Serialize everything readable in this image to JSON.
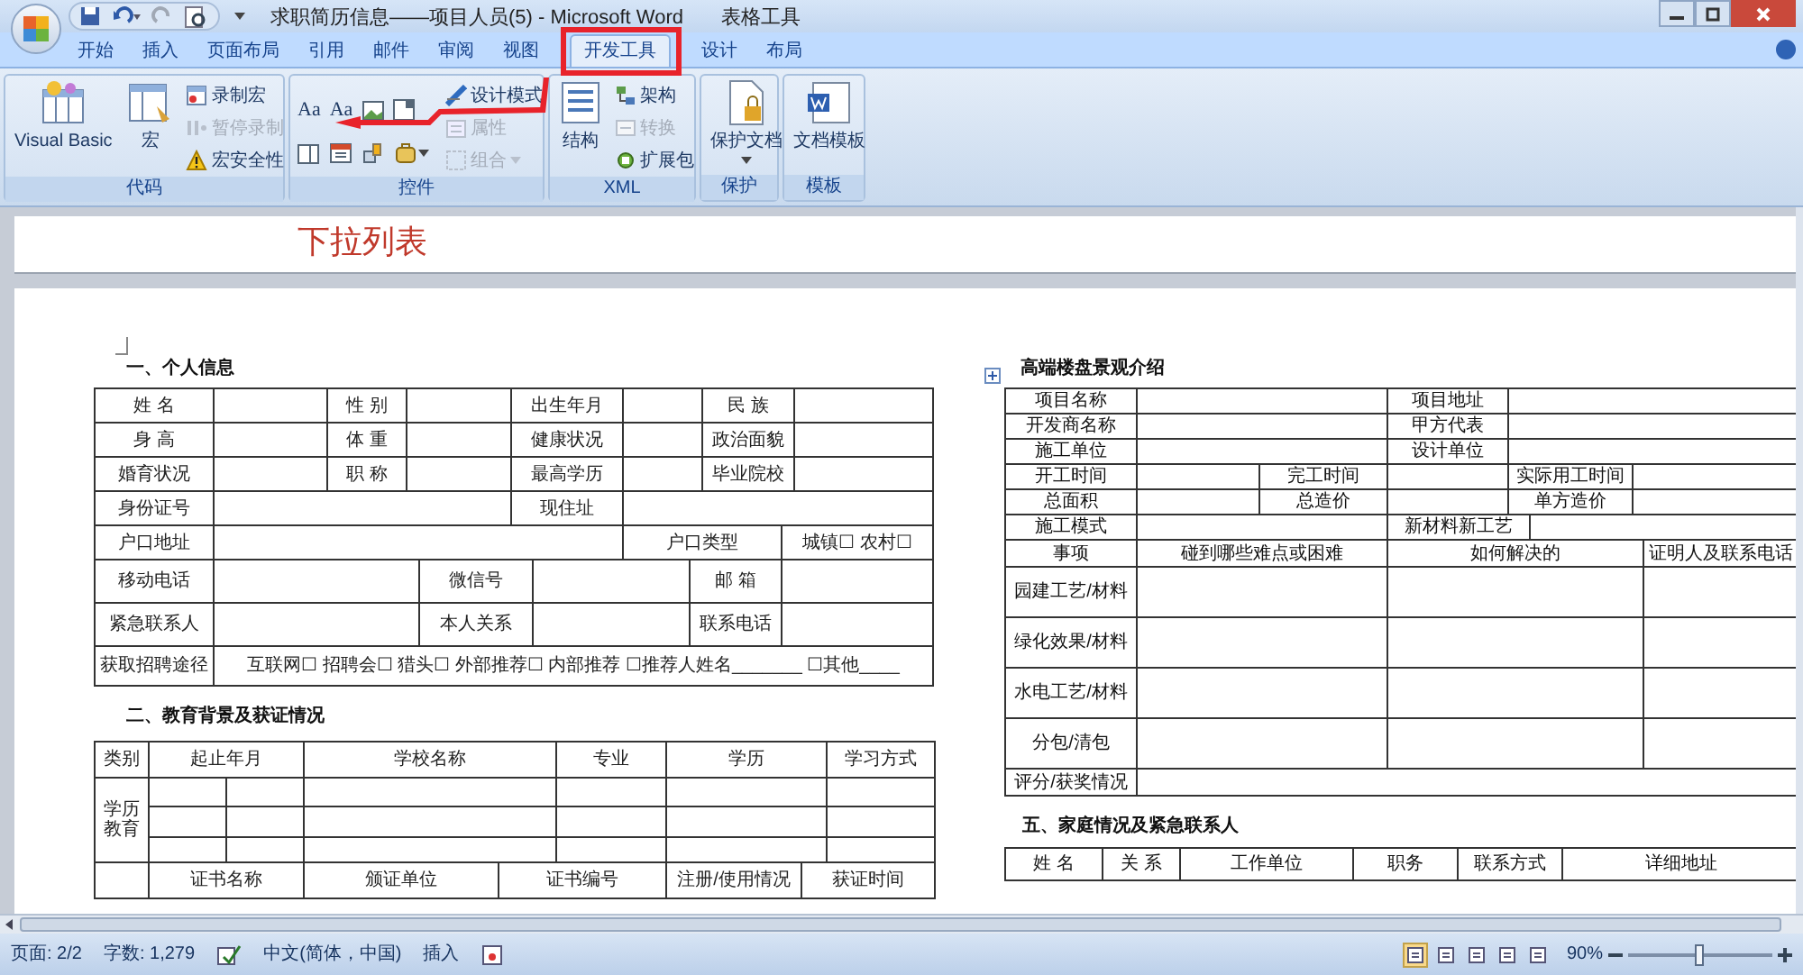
{
  "window": {
    "title": "求职简历信息——项目人员(5) - Microsoft Word",
    "context_label": "表格工具"
  },
  "tabs": [
    {
      "label": "开始",
      "selected": false
    },
    {
      "label": "插入",
      "selected": false
    },
    {
      "label": "页面布局",
      "selected": false
    },
    {
      "label": "引用",
      "selected": false
    },
    {
      "label": "邮件",
      "selected": false
    },
    {
      "label": "审阅",
      "selected": false
    },
    {
      "label": "视图",
      "selected": false
    },
    {
      "label": "开发工具",
      "selected": true
    },
    {
      "label": "设计",
      "selected": false
    },
    {
      "label": "布局",
      "selected": false
    }
  ],
  "ribbon": {
    "groups": [
      {
        "label": "代码",
        "items": [
          {
            "label": "Visual Basic",
            "disabled": false
          },
          {
            "label": "宏",
            "disabled": false
          },
          {
            "label": "录制宏",
            "disabled": false
          },
          {
            "label": "暂停录制",
            "disabled": true
          },
          {
            "label": "宏安全性",
            "disabled": false
          }
        ]
      },
      {
        "label": "控件",
        "items": [
          {
            "label": "Aa",
            "disabled": false
          },
          {
            "label": "Aa",
            "disabled": false
          },
          {
            "label": "设计模式",
            "disabled": false
          },
          {
            "label": "属性",
            "disabled": true
          },
          {
            "label": "组合",
            "disabled": true
          }
        ]
      },
      {
        "label": "XML",
        "items": [
          {
            "label": "结构",
            "disabled": false
          },
          {
            "label": "架构",
            "disabled": false
          },
          {
            "label": "转换",
            "disabled": true
          },
          {
            "label": "扩展包",
            "disabled": false
          }
        ]
      },
      {
        "label": "保护",
        "items": [
          {
            "label": "保护文档",
            "disabled": false
          }
        ]
      },
      {
        "label": "模板",
        "items": [
          {
            "label": "文档模板",
            "disabled": false
          }
        ]
      }
    ]
  },
  "document": {
    "previous_page": {
      "text": "下拉列表"
    },
    "left_column": [
      {
        "title": "一、个人信息",
        "table": {
          "rows": [
            [
              {
                "text": "姓 名"
              },
              {
                "text": ""
              },
              {
                "text": "性 别"
              },
              {
                "text": "",
                "colspan": 2
              },
              {
                "text": "出生年月",
                "colspan": 2
              },
              {
                "text": "",
                "colspan": 2
              },
              {
                "text": "民 族",
                "colspan": 2
              },
              {
                "text": ""
              }
            ],
            [
              {
                "text": "身 高"
              },
              {
                "text": ""
              },
              {
                "text": "体 重"
              },
              {
                "text": "",
                "colspan": 2
              },
              {
                "text": "健康状况",
                "colspan": 2
              },
              {
                "text": "",
                "colspan": 2
              },
              {
                "text": "政治面貌",
                "colspan": 2
              },
              {
                "text": ""
              }
            ],
            [
              {
                "text": "婚育状况"
              },
              {
                "text": ""
              },
              {
                "text": "职 称"
              },
              {
                "text": "",
                "colspan": 2
              },
              {
                "text": "最高学历",
                "colspan": 2
              },
              {
                "text": "",
                "colspan": 2
              },
              {
                "text": "毕业院校",
                "colspan": 2
              },
              {
                "text": ""
              }
            ],
            [
              {
                "text": "身份证号"
              },
              {
                "text": "",
                "colspan": 4
              },
              {
                "text": "现住址",
                "colspan": 2
              },
              {
                "text": "",
                "colspan": 5
              }
            ],
            [
              {
                "text": "户口地址"
              },
              {
                "text": "",
                "colspan": 6
              },
              {
                "text": "户口类型",
                "colspan": 3
              },
              {
                "text": "城镇☐ 农村☐",
                "colspan": 2
              }
            ],
            [
              {
                "text": "移动电话"
              },
              {
                "text": "",
                "colspan": 3
              },
              {
                "text": "微信号",
                "colspan": 2
              },
              {
                "text": "",
                "colspan": 2
              },
              {
                "text": "邮 箱",
                "colspan": 2
              },
              {
                "text": "",
                "colspan": 2
              }
            ],
            [
              {
                "text": "紧急联系人"
              },
              {
                "text": "",
                "colspan": 3
              },
              {
                "text": "本人关系",
                "colspan": 2
              },
              {
                "text": "",
                "colspan": 2
              },
              {
                "text": "联系电话",
                "colspan": 2
              },
              {
                "text": "",
                "colspan": 2
              }
            ],
            [
              {
                "text": "获取招聘途径"
              },
              {
                "text": "互联网☐ 招聘会☐ 猎头☐ 外部推荐☐ 内部推荐 ☐推荐人姓名_______ ☐其他____",
                "colspan": 11
              }
            ]
          ]
        }
      },
      {
        "title": "二、教育背景及获证情况",
        "table": {
          "rows": [
            [
              {
                "text": "类别"
              },
              {
                "text": "起止年月",
                "colspan": 2
              },
              {
                "text": "学校名称",
                "colspan": 2
              },
              {
                "text": "专业"
              },
              {
                "text": "学历",
                "colspan": 2
              },
              {
                "text": "学习方式"
              }
            ],
            [
              {
                "text": "学历教育",
                "rowspan": 3
              },
              {
                "text": ""
              },
              {
                "text": ""
              },
              {
                "text": "",
                "colspan": 2
              },
              {
                "text": ""
              },
              {
                "text": "",
                "colspan": 2
              },
              {
                "text": ""
              }
            ],
            [
              {
                "text": ""
              },
              {
                "text": ""
              },
              {
                "text": "",
                "colspan": 2
              },
              {
                "text": ""
              },
              {
                "text": "",
                "colspan": 2
              },
              {
                "text": ""
              }
            ],
            [
              {
                "text": ""
              },
              {
                "text": ""
              },
              {
                "text": "",
                "colspan": 2
              },
              {
                "text": ""
              },
              {
                "text": "",
                "colspan": 2
              },
              {
                "text": ""
              }
            ],
            [
              {
                "text": ""
              },
              {
                "text": "证书名称",
                "colspan": 2
              },
              {
                "text": "颁证单位"
              },
              {
                "text": "证书编号",
                "colspan": 2
              },
              {
                "text": "注册/使用情况"
              },
              {
                "text": "获证时间",
                "colspan": 2
              }
            ]
          ]
        }
      }
    ],
    "right_column": [
      {
        "title": "高端楼盘景观介绍",
        "table": {
          "rows": [
            [
              {
                "text": "项目名称"
              },
              {
                "text": "",
                "colspan": 2
              },
              {
                "text": "项目地址"
              },
              {
                "text": "",
                "colspan": 4
              }
            ],
            [
              {
                "text": "开发商名称"
              },
              {
                "text": "",
                "colspan": 2
              },
              {
                "text": "甲方代表"
              },
              {
                "text": "",
                "colspan": 4
              }
            ],
            [
              {
                "text": "施工单位"
              },
              {
                "text": "",
                "colspan": 2
              },
              {
                "text": "设计单位"
              },
              {
                "text": "",
                "colspan": 4
              }
            ],
            [
              {
                "text": "开工时间"
              },
              {
                "text": ""
              },
              {
                "text": "完工时间"
              },
              {
                "text": ""
              },
              {
                "text": "实际用工时间",
                "colspan": 2
              },
              {
                "text": "",
                "colspan": 2
              }
            ],
            [
              {
                "text": "总面积"
              },
              {
                "text": ""
              },
              {
                "text": "总造价"
              },
              {
                "text": ""
              },
              {
                "text": "单方造价",
                "colspan": 2
              },
              {
                "text": "",
                "colspan": 2
              }
            ],
            [
              {
                "text": "施工模式"
              },
              {
                "text": "",
                "colspan": 2
              },
              {
                "text": "新材料新工艺",
                "colspan": 2
              },
              {
                "text": "",
                "colspan": 3
              }
            ],
            [
              {
                "text": "事项"
              },
              {
                "text": "碰到哪些难点或困难",
                "colspan": 2
              },
              {
                "text": "如何解决的",
                "colspan": 4
              },
              {
                "text": "证明人及联系电话"
              }
            ],
            [
              {
                "text": "园建工艺/材料"
              },
              {
                "text": "",
                "colspan": 2
              },
              {
                "text": "",
                "colspan": 4
              },
              {
                "text": ""
              }
            ],
            [
              {
                "text": "绿化效果/材料"
              },
              {
                "text": "",
                "colspan": 2
              },
              {
                "text": "",
                "colspan": 4
              },
              {
                "text": ""
              }
            ],
            [
              {
                "text": "水电工艺/材料"
              },
              {
                "text": "",
                "colspan": 2
              },
              {
                "text": "",
                "colspan": 4
              },
              {
                "text": ""
              }
            ],
            [
              {
                "text": "分包/清包"
              },
              {
                "text": "",
                "colspan": 2
              },
              {
                "text": "",
                "colspan": 4
              },
              {
                "text": ""
              }
            ],
            [
              {
                "text": "评分/获奖情况"
              },
              {
                "text": "",
                "colspan": 7
              }
            ]
          ]
        }
      },
      {
        "title": "五、家庭情况及紧急联系人",
        "table": {
          "rows": [
            [
              {
                "text": "姓 名"
              },
              {
                "text": "关 系"
              },
              {
                "text": "工作单位"
              },
              {
                "text": "职务"
              },
              {
                "text": "联系方式"
              },
              {
                "text": "详细地址"
              }
            ]
          ]
        }
      }
    ]
  },
  "status_bar": {
    "page": "页面: 2/2",
    "words": "字数: 1,279",
    "language": "中文(简体，中国)",
    "mode": "插入",
    "zoom": "90%",
    "zoom_slider": {
      "level": 0.5
    }
  }
}
